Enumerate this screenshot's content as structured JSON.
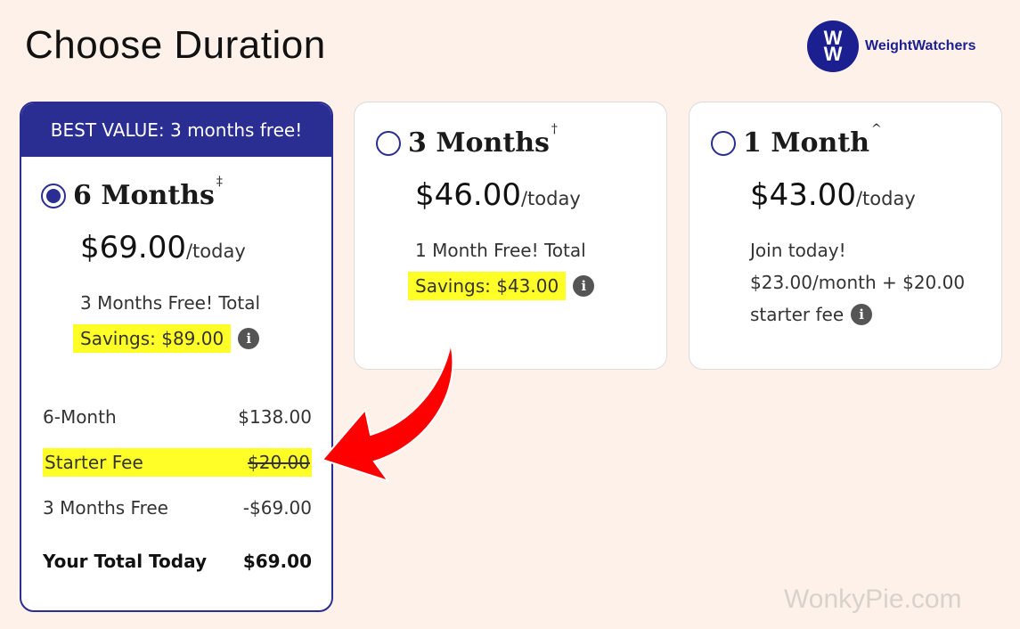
{
  "page": {
    "title": "Choose Duration"
  },
  "brand": {
    "logo_top": "W",
    "logo_bottom": "W",
    "name": "WeightWatchers",
    "color": "#1b1f8f"
  },
  "plans": [
    {
      "banner": "BEST VALUE: 3 months free!",
      "name": "6 Months",
      "mark": "‡",
      "selected": true,
      "price": "$69.00",
      "price_suffix": "/today",
      "desc_line1": "3 Months Free! Total",
      "savings": "Savings: $89.00",
      "breakdown": [
        {
          "label": "6-Month",
          "value": "$138.00"
        },
        {
          "label": "Starter Fee",
          "value": "$20.00"
        },
        {
          "label": "3 Months Free",
          "value": "-$69.00"
        },
        {
          "label": "Your Total Today",
          "value": "$69.00"
        }
      ]
    },
    {
      "name": "3 Months",
      "mark": "†",
      "selected": false,
      "price": "$46.00",
      "price_suffix": "/today",
      "desc_line1": "1 Month Free! Total",
      "savings": "Savings: $43.00"
    },
    {
      "name": "1 Month",
      "mark": "^",
      "selected": false,
      "price": "$43.00",
      "price_suffix": "/today",
      "desc_line1": "Join today!",
      "desc_line2": "$23.00/month + $20.00",
      "desc_line3": "starter fee"
    }
  ],
  "info_icon_glyph": "i",
  "colors": {
    "accent": "#2a2d92",
    "highlight": "#ffff27",
    "arrow": "#ff0000",
    "background": "#fdf1ea"
  },
  "watermark": "WonkyPie.com"
}
